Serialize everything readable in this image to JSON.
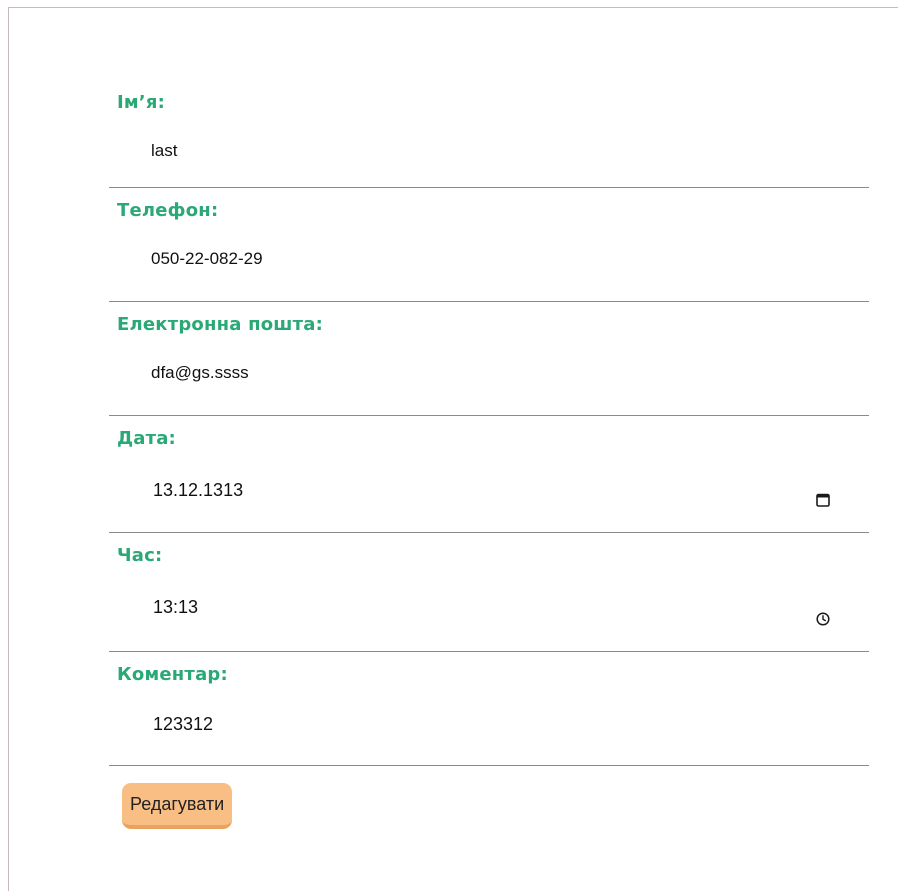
{
  "form": {
    "fields": [
      {
        "label": "Ім’я:",
        "value": "last"
      },
      {
        "label": "Телефон:",
        "value": "050-22-082-29"
      },
      {
        "label": "Електронна пошта:",
        "value": "dfa@gs.ssss"
      },
      {
        "label": "Дата:",
        "value": "13.12.1313",
        "icon": "calendar-icon"
      },
      {
        "label": "Час:",
        "value": "13:13",
        "icon": "clock-icon"
      },
      {
        "label": "Коментар:",
        "value": "123312"
      }
    ],
    "edit_label": "Редагувати"
  },
  "colors": {
    "label": "#2aa876",
    "button": "#f9be84",
    "button_shadow": "#e9a35e",
    "divider": "#8a8a8a"
  }
}
